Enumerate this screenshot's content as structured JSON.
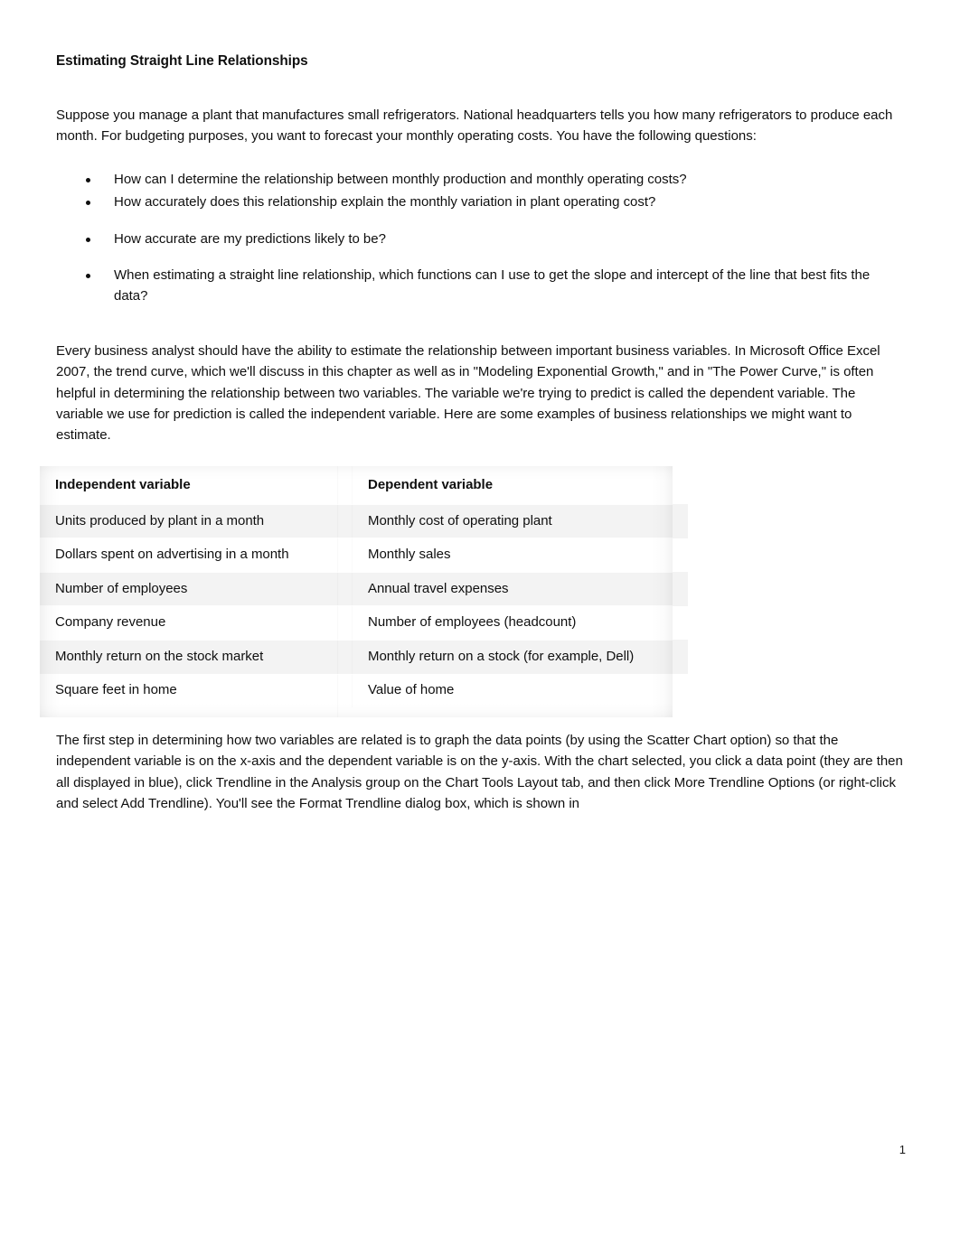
{
  "document": {
    "title": "Estimating Straight Line Relationships",
    "intro_paragraph": "Suppose you manage a plant that manufactures small refrigerators. National headquarters tells you how many refrigerators to produce each month. For budgeting purposes, you want to forecast your monthly operating costs. You have the following questions:",
    "questions": [
      "How can I determine the relationship between monthly production and monthly operating costs?",
      "How accurately does this relationship explain the monthly variation in plant operating cost?",
      "How accurate are my predictions likely to be?",
      "When estimating a straight line relationship, which functions can I use to get the slope and intercept of the line that best fits the data?"
    ],
    "body_paragraph": "Every business analyst should have the ability to estimate the relationship between important business variables. In Microsoft Office Excel 2007, the trend curve, which we'll discuss in this chapter as well as in \"Modeling Exponential Growth,\" and in \"The Power Curve,\" is often helpful in determining the relationship between two variables. The variable we're trying to predict is called the dependent variable. The variable we use for prediction is called the independent variable. Here are some examples of business relationships we might want to estimate.",
    "closing_paragraph": "The first step in determining how two variables are related is to graph the data points (by using the Scatter Chart option) so that the independent variable is on the x-axis and the dependent variable is on the y-axis. With the chart selected, you click a data point (they are then all displayed in blue), click Trendline in the Analysis group on the Chart Tools Layout tab, and then click More Trendline Options (or right-click and select Add Trendline). You'll see the Format Trendline dialog box, which is shown in",
    "page_number": "1"
  },
  "table": {
    "headers": [
      "Independent variable",
      "Dependent variable"
    ],
    "rows": [
      [
        "Units produced by plant in a month",
        "Monthly cost of operating plant"
      ],
      [
        "Dollars spent on advertising in a month",
        "Monthly sales"
      ],
      [
        "Number of employees",
        "Annual travel expenses"
      ],
      [
        "Company revenue",
        "Number of employees (headcount)"
      ],
      [
        "Monthly return on the stock market",
        "Monthly return on a stock (for example, Dell)"
      ],
      [
        "Square feet in home",
        "Value of home"
      ]
    ]
  }
}
